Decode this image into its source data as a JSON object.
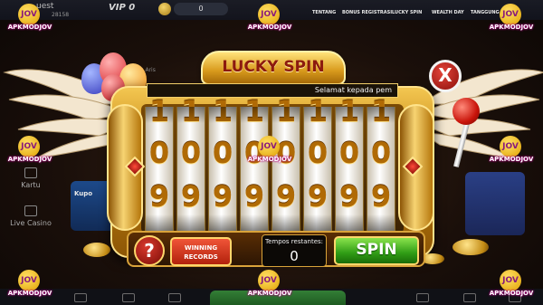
{
  "lobby": {
    "guest_label": "uest",
    "guest_id": "28158",
    "vip": "VIP 0",
    "coins": "0",
    "promos": [
      "TENTANG",
      "BONUS REGISTRASI",
      "LUCKY SPIN",
      "WEALTH DAY",
      "TANGGUNG JAWAB"
    ],
    "side_items": [
      "Kartu",
      "Live Casino"
    ],
    "left_card_label": "Kupo",
    "marquee_partial": "kku Aris"
  },
  "spin": {
    "banner": "LUCKY SPIN",
    "marquee_text": "Selamat kepada pem",
    "close_label": "X",
    "reels": [
      {
        "top": "1",
        "mid": "0",
        "bot": "9"
      },
      {
        "top": "1",
        "mid": "0",
        "bot": "9"
      },
      {
        "top": "1",
        "mid": "0",
        "bot": "9"
      },
      {
        "top": "1",
        "mid": "0",
        "bot": "9"
      },
      {
        "top": "1",
        "mid": "0",
        "bot": "9"
      },
      {
        "top": "1",
        "mid": "0",
        "bot": "9"
      },
      {
        "top": "1",
        "mid": "0",
        "bot": "9"
      },
      {
        "top": "1",
        "mid": "0",
        "bot": "9"
      }
    ],
    "help_label": "?",
    "records_line1": "WINNING",
    "records_line2": "RECORDS",
    "tempos_label": "Tempos restantes:",
    "tempos_value": "0",
    "spin_label": "SPIN"
  },
  "watermark": {
    "logo_text": "JOV",
    "site_text": "APKMODJOV"
  },
  "colors": {
    "gold": "#d89a1c",
    "spin_green": "#2f9c15",
    "close_red": "#c9140a",
    "watermark_yellow": "#ffe066"
  }
}
